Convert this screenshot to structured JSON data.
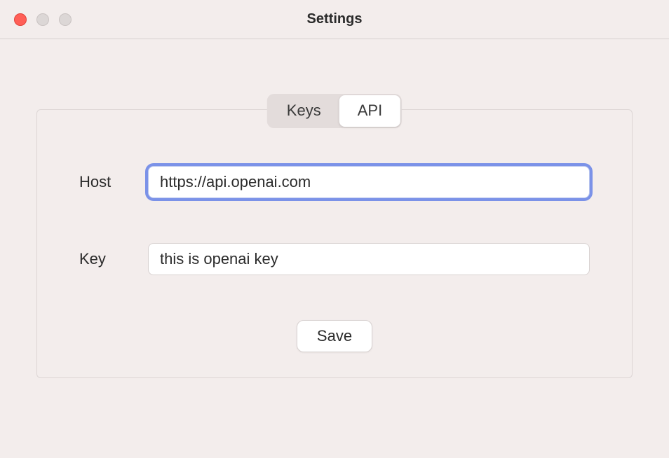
{
  "window": {
    "title": "Settings"
  },
  "tabs": {
    "keys_label": "Keys",
    "api_label": "API",
    "active": "API"
  },
  "form": {
    "host_label": "Host",
    "host_value": "https://api.openai.com",
    "key_label": "Key",
    "key_value": "this is openai key",
    "save_label": "Save"
  }
}
